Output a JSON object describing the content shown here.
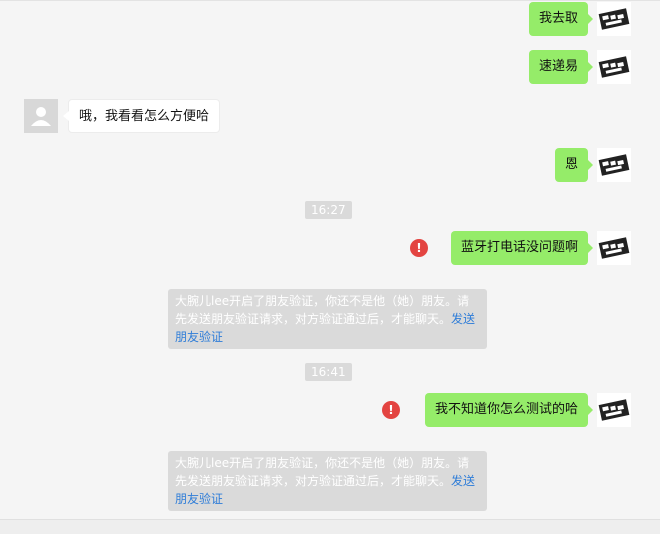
{
  "messages": {
    "m1": "我去取",
    "m2": "速递易",
    "m3": "哦，我看看怎么方便哈",
    "m4": "恩",
    "m5": "蓝牙打电话没问题啊",
    "m6": "我不知道你怎么测试的哈"
  },
  "times": {
    "t1": "16:27",
    "t2": "16:41"
  },
  "system_notice": {
    "text": "大腕儿lee开启了朋友验证，你还不是他（她）朋友。请先发送朋友验证请求，对方验证通过后，才能聊天。",
    "link": "发送朋友验证"
  },
  "colors": {
    "outgoing_bubble": "#95ec69",
    "error": "#e34441",
    "link": "#2f7dd8"
  }
}
